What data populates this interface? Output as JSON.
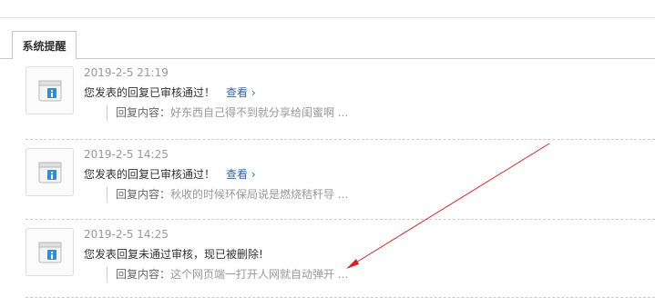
{
  "tab": {
    "label": "系统提醒"
  },
  "notifications": [
    {
      "time": "2019-2-5 21:19",
      "message": "您发表的回复已审核通过！",
      "view_label": "查看 ›",
      "reply_label": "回复内容：",
      "reply_text": "好东西自己得不到就分享给闺蜜啊 ..."
    },
    {
      "time": "2019-2-5 14:25",
      "message": "您发表的回复已审核通过！",
      "view_label": "查看 ›",
      "reply_label": "回复内容：",
      "reply_text": "秋收的时候环保局说是燃烧秸秆导 ..."
    },
    {
      "time": "2019-2-5 14:25",
      "message": "您发表回复未通过审核，现已被删除!",
      "reply_label": "回复内容：",
      "reply_text": "这个网页端一打开人网就自动弹开 ..."
    }
  ],
  "colors": {
    "link": "#336699",
    "annotation_arrow": "#e02020",
    "icon_blue": "#2a8fd6"
  },
  "icons": {
    "notification": "window-info-icon"
  }
}
